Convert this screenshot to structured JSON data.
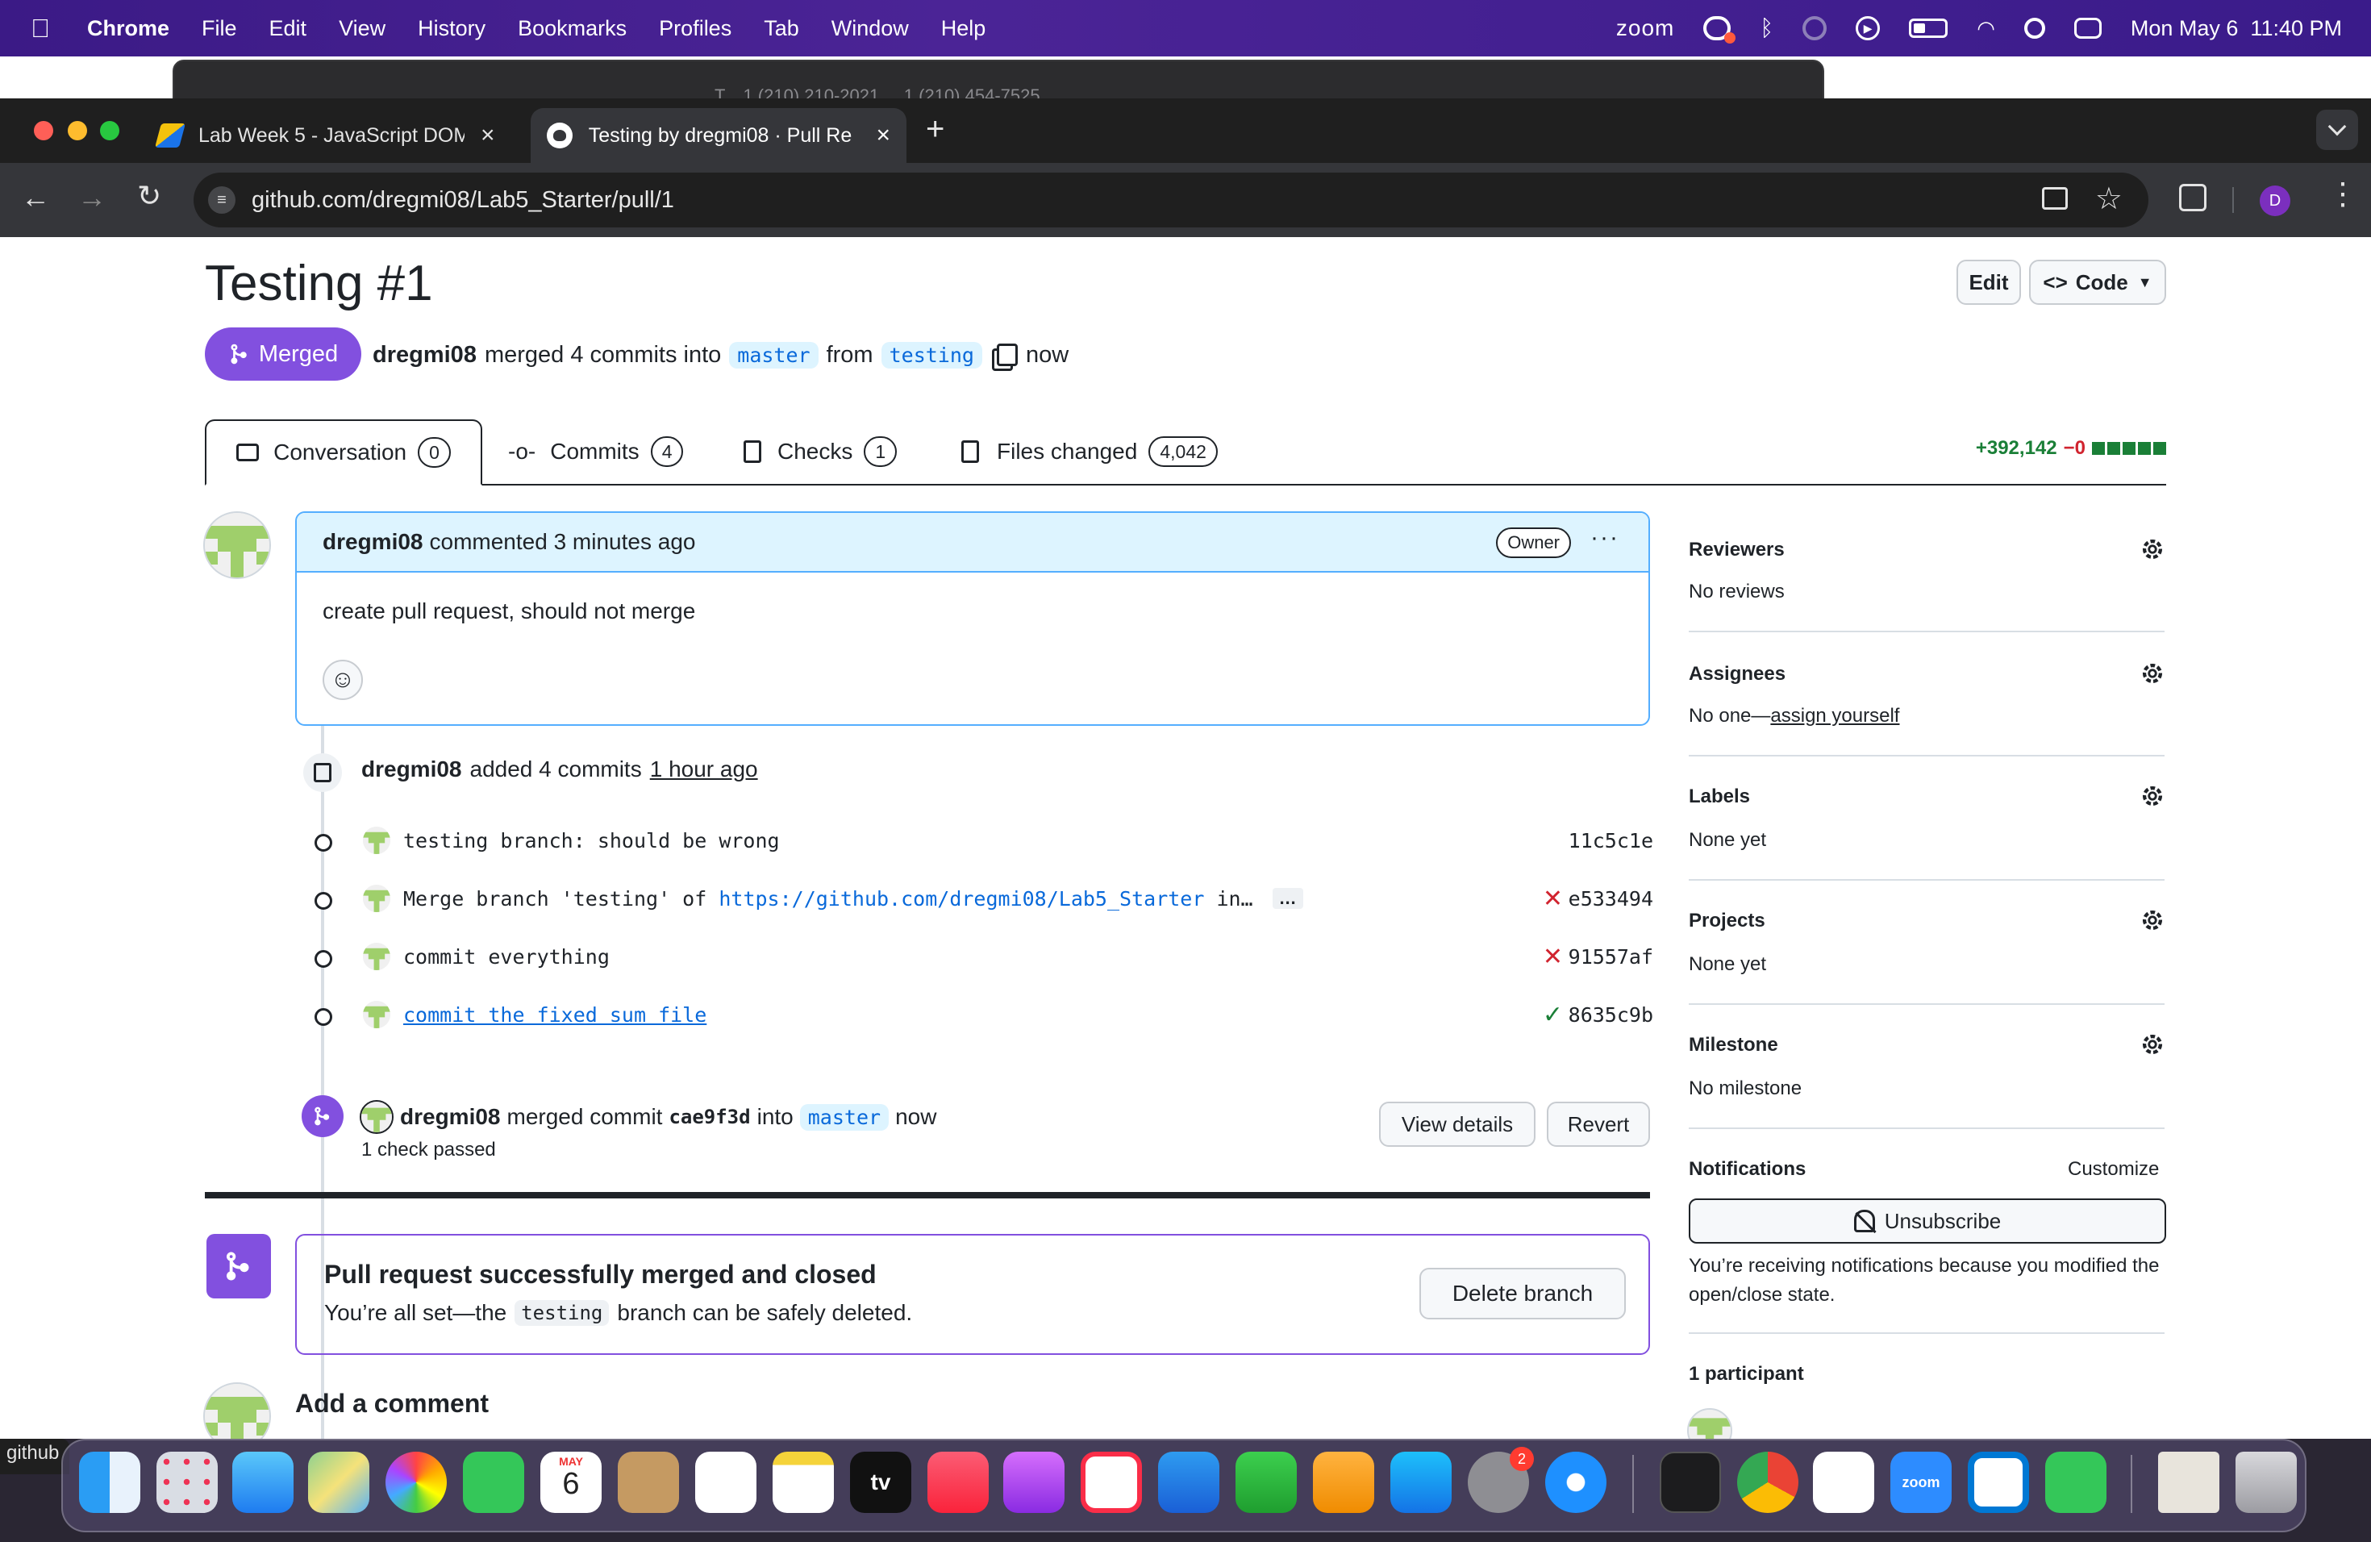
{
  "menubar": {
    "app": "Chrome",
    "items": [
      "File",
      "Edit",
      "View",
      "History",
      "Bookmarks",
      "Profiles",
      "Tab",
      "Window",
      "Help"
    ],
    "zoom": "zoom",
    "datetime": "Mon May 6  11:40 PM"
  },
  "bg_window": {
    "text": "T... 1 (210) 210-2021 ... 1 (210) 454-7525"
  },
  "browser": {
    "tabs": [
      {
        "title": "Lab Week 5 - JavaScript DOM"
      },
      {
        "title": "Testing by dregmi08 · Pull Re"
      }
    ],
    "url": "github.com/dregmi08/Lab5_Starter/pull/1",
    "profile_initial": "D"
  },
  "pr": {
    "title": "Testing #1",
    "edit_label": "Edit",
    "code_label": "Code",
    "state_label": "Merged",
    "author": "dregmi08",
    "merged_text": "merged 4 commits into",
    "base_branch": "master",
    "from_text": "from",
    "head_branch": "testing",
    "time": "now",
    "tabs": [
      {
        "label": "Conversation",
        "count": "0"
      },
      {
        "label": "Commits",
        "count": "4"
      },
      {
        "label": "Checks",
        "count": "1"
      },
      {
        "label": "Files changed",
        "count": "4,042"
      }
    ],
    "additions": "+392,142",
    "deletions": "−0"
  },
  "comment": {
    "author": "dregmi08",
    "meta": "commented 3 minutes ago",
    "badge": "Owner",
    "body": "create pull request, should not merge"
  },
  "commits_event": {
    "author": "dregmi08",
    "text": "added 4 commits",
    "time": "1 hour ago",
    "commits": [
      {
        "message": "testing branch: should be wrong",
        "sha": "11c5c1e",
        "status": ""
      },
      {
        "message_prefix": "Merge branch 'testing' of ",
        "link": "https://github.com/dregmi08/Lab5_Starter",
        "message_suffix": " in…",
        "ellipsis": "…",
        "sha": "e533494",
        "status": "fail"
      },
      {
        "message": "commit everything",
        "sha": "91557af",
        "status": "fail"
      },
      {
        "message": "commit the fixed sum file",
        "sha": "8635c9b",
        "status": "pass"
      }
    ]
  },
  "merge_event": {
    "author": "dregmi08",
    "text": "merged commit",
    "sha": "cae9f3d",
    "into": "into",
    "branch": "master",
    "time": "now",
    "checks": "1 check passed",
    "view_details": "View details",
    "revert": "Revert"
  },
  "merged_box": {
    "title": "Pull request successfully merged and closed",
    "text_before": "You’re all set—the",
    "branch": "testing",
    "text_after": "branch can be safely deleted.",
    "delete_button": "Delete branch"
  },
  "add_comment": {
    "title": "Add a comment"
  },
  "sidebar": {
    "reviewers": {
      "label": "Reviewers",
      "value": "No reviews"
    },
    "assignees": {
      "label": "Assignees",
      "value": "No one—",
      "link": "assign yourself"
    },
    "labels": {
      "label": "Labels",
      "value": "None yet"
    },
    "projects": {
      "label": "Projects",
      "value": "None yet"
    },
    "milestone": {
      "label": "Milestone",
      "value": "No milestone"
    },
    "notifications": {
      "label": "Notifications",
      "customize": "Customize",
      "button": "Unsubscribe",
      "reason": "You’re receiving notifications because you modified the open/close state."
    },
    "participants": {
      "label": "1 participant"
    }
  },
  "dock": {
    "calendar_month": "MAY",
    "calendar_day": "6",
    "settings_badge": "2",
    "tv_label": "tv",
    "zoom_label": "zoom"
  },
  "status_url_hint": "github"
}
